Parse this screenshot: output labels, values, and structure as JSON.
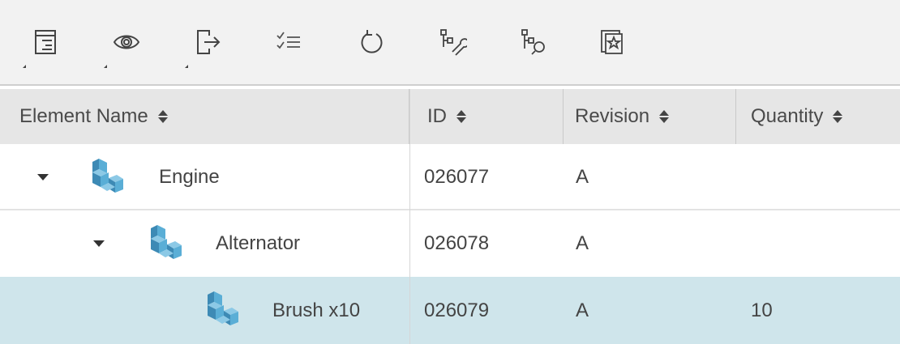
{
  "toolbar": {
    "tools": [
      {
        "icon": "tree-structure-icon"
      },
      {
        "icon": "eye-icon"
      },
      {
        "icon": "export-icon"
      },
      {
        "icon": "checklist-icon"
      },
      {
        "icon": "undo-icon"
      },
      {
        "icon": "structure-tools-icon"
      },
      {
        "icon": "structure-search-icon"
      },
      {
        "icon": "bookmark-star-icon"
      }
    ]
  },
  "table": {
    "columns": [
      {
        "label": "Element Name"
      },
      {
        "label": "ID"
      },
      {
        "label": "Revision"
      },
      {
        "label": "Quantity"
      }
    ],
    "rows": [
      {
        "name": "Engine",
        "id": "026077",
        "revision": "A",
        "quantity": "",
        "expanded": true,
        "selected": false
      },
      {
        "name": "Alternator",
        "id": "026078",
        "revision": "A",
        "quantity": "",
        "expanded": true,
        "selected": false
      },
      {
        "name": "Brush x10",
        "id": "026079",
        "revision": "A",
        "quantity": "10",
        "expanded": false,
        "selected": true
      }
    ]
  },
  "colors": {
    "toolbar_bg": "#f2f2f2",
    "header_bg": "#e6e6e6",
    "selected_row": "#cfe5eb",
    "part_icon": "#4f9fc7"
  }
}
